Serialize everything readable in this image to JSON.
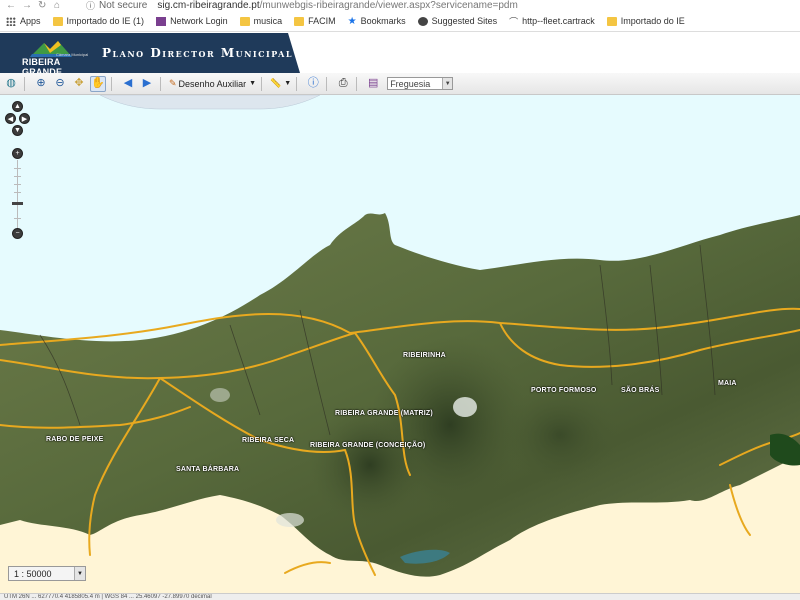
{
  "browser": {
    "security_label": "Not secure",
    "url_host": "sig.cm-ribeiragrande.pt",
    "url_path": "/munwebgis-ribeiragrande/viewer.aspx?servicename=pdm"
  },
  "bookmarks": [
    {
      "label": "Apps",
      "icon": "apps-grid-icon"
    },
    {
      "label": "Importado do IE (1)",
      "icon": "folder-icon"
    },
    {
      "label": "Network Login",
      "icon": "network-login-icon"
    },
    {
      "label": "musica",
      "icon": "folder-icon"
    },
    {
      "label": "FACIM",
      "icon": "folder-icon"
    },
    {
      "label": "Bookmarks",
      "icon": "star-icon"
    },
    {
      "label": "Suggested Sites",
      "icon": "globe-icon"
    },
    {
      "label": "http--fleet.cartrack",
      "icon": "arc-icon"
    },
    {
      "label": "Importado do IE",
      "icon": "folder-icon"
    }
  ],
  "header": {
    "logo_text": "RIBEIRA GRANDE",
    "logo_small": "Câmara Municipal",
    "title": "Plano Director Municipal",
    "brand_color": "#1f3a5a"
  },
  "toolbar": {
    "drawing_label": "Desenho Auxiliar",
    "layer_select_value": "Freguesia"
  },
  "map": {
    "places": [
      "RIBEIRINHA",
      "PORTO FORMOSO",
      "SÃO BRÁS",
      "MAIA",
      "RIBEIRA GRANDE (MATRIZ)",
      "RABO DE PEIXE",
      "RIBEIRA SECA",
      "RIBEIRA GRANDE (CONCEIÇÃO)",
      "SANTA BÁRBARA"
    ],
    "scale_value": "1 : 50000"
  },
  "status_bar": {
    "text": "UTM 26N ... 627770.4 4185805.4 m | WGS 84 ... 25.46097 -27.89970 decimal"
  },
  "colors": {
    "sea": "#e6fbfe",
    "roads": "#e8a91f",
    "land": "#5b6b3d",
    "unmapped": "#fff5d6"
  }
}
